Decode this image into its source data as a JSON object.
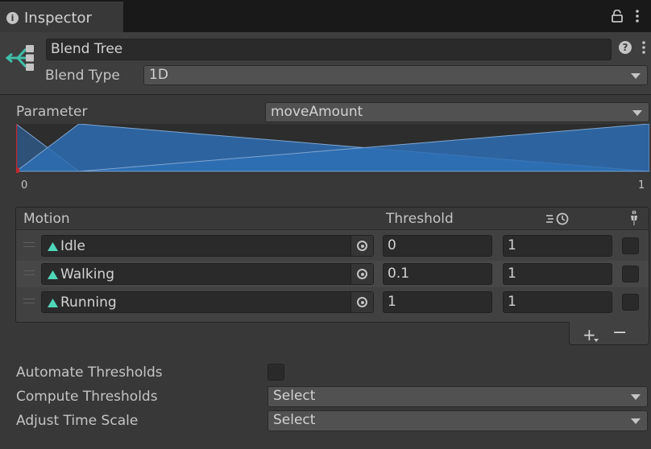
{
  "window": {
    "tab_title": "Inspector"
  },
  "header": {
    "name": "Blend Tree",
    "blend_type_label": "Blend Type",
    "blend_type_value": "1D"
  },
  "parameter": {
    "label": "Parameter",
    "value": "moveAmount"
  },
  "graph": {
    "min_label": "0",
    "max_label": "1"
  },
  "motions": {
    "columns": {
      "motion": "Motion",
      "threshold": "Threshold"
    },
    "rows": [
      {
        "name": "Idle",
        "threshold": "0",
        "speed": "1",
        "mirror": false
      },
      {
        "name": "Walking",
        "threshold": "0.1",
        "speed": "1",
        "mirror": false
      },
      {
        "name": "Running",
        "threshold": "1",
        "speed": "1",
        "mirror": false
      }
    ],
    "add_label": "+",
    "remove_label": "−"
  },
  "options": {
    "automate_label": "Automate Thresholds",
    "automate_checked": false,
    "compute_label": "Compute Thresholds",
    "compute_value": "Select",
    "adjust_label": "Adjust Time Scale",
    "adjust_value": "Select"
  },
  "colors": {
    "blend_fill": "#2e6fb4",
    "blend_edge": "#7fa6d2",
    "clip_icon": "#4fd6b8",
    "marker": "#c0282e"
  }
}
